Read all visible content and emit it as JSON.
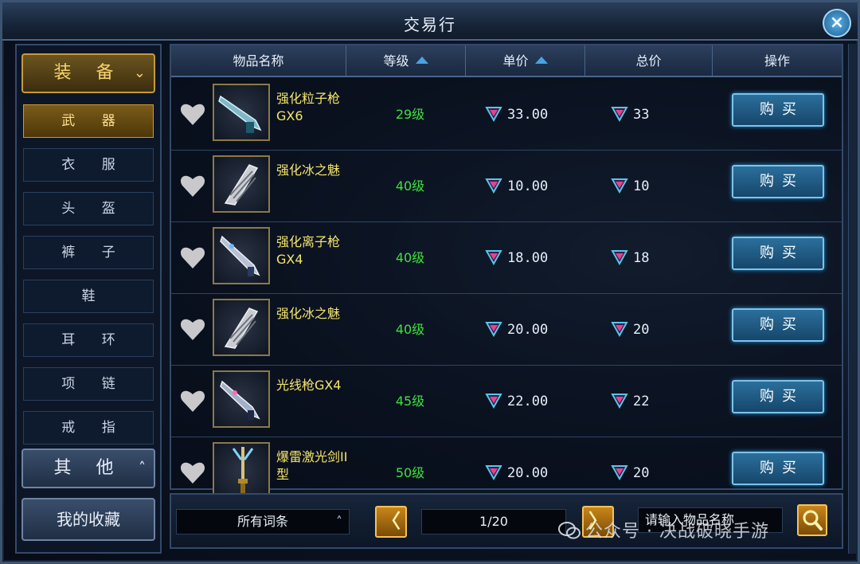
{
  "window": {
    "title": "交易行"
  },
  "sidebar": {
    "equip_label": "装 备",
    "items": [
      {
        "label": "武 器",
        "active": true
      },
      {
        "label": "衣 服"
      },
      {
        "label": "头 盔"
      },
      {
        "label": "裤 子"
      },
      {
        "label": "鞋"
      },
      {
        "label": "耳 环"
      },
      {
        "label": "项 链"
      },
      {
        "label": "戒 指"
      }
    ],
    "other_label": "其 他",
    "favorites_label": "我的收藏"
  },
  "table": {
    "headers": {
      "name": "物品名称",
      "level": "等级",
      "unit_price": "单价",
      "total_price": "总价",
      "action": "操作"
    },
    "rows": [
      {
        "name": "强化粒子枪GX6",
        "level": "29级",
        "unit_price": "33.00",
        "total": "33",
        "buy": "购买",
        "icon": "particle-gun-icon"
      },
      {
        "name": "强化冰之魅",
        "level": "40级",
        "unit_price": "10.00",
        "total": "10",
        "buy": "购买",
        "icon": "ice-claw-icon"
      },
      {
        "name": "强化离子枪GX4",
        "level": "40级",
        "unit_price": "18.00",
        "total": "18",
        "buy": "购买",
        "icon": "ion-gun-icon"
      },
      {
        "name": "强化冰之魅",
        "level": "40级",
        "unit_price": "20.00",
        "total": "20",
        "buy": "购买",
        "icon": "ice-claw-icon"
      },
      {
        "name": "光线枪GX4",
        "level": "45级",
        "unit_price": "22.00",
        "total": "22",
        "buy": "购买",
        "icon": "ray-gun-icon"
      },
      {
        "name": "爆雷激光剑II型",
        "level": "50级",
        "unit_price": "20.00",
        "total": "20",
        "buy": "购买",
        "icon": "laser-sword-icon"
      }
    ]
  },
  "bottom": {
    "filter": "所有词条",
    "prev": "〈",
    "page": "1/20",
    "next": "〉",
    "search_placeholder": "请输入物品名称"
  },
  "watermark": "公众号 · 决战破晓手游",
  "colors": {
    "gold": "#f3e56b",
    "level_green": "#3fe03f",
    "buy_blue": "#2b6f9c",
    "accent_orange": "#c8861a"
  }
}
